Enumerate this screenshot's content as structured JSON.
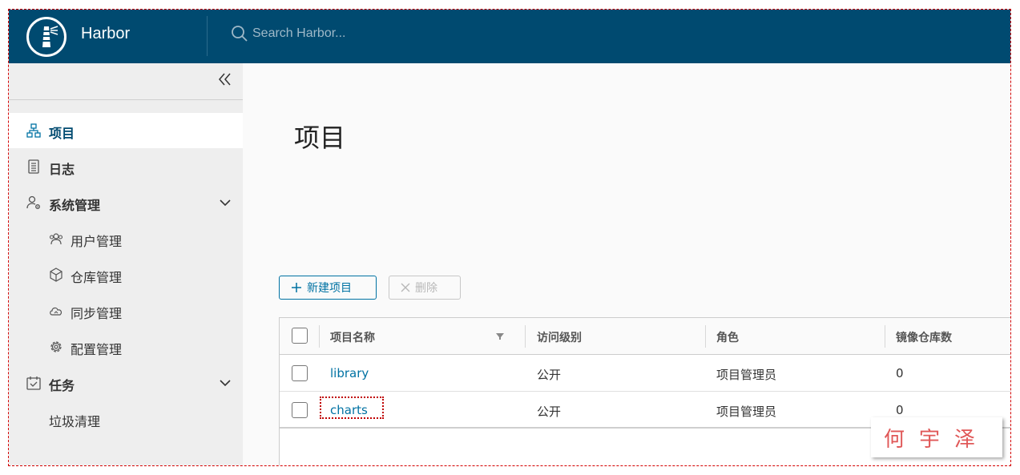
{
  "header": {
    "brand": "Harbor",
    "search_placeholder": "Search Harbor...",
    "color": "#004a70"
  },
  "sidebar": {
    "collapse_icon": "double-chevron-left-icon",
    "items": [
      {
        "label": "项目",
        "icon": "projects-icon",
        "active": true
      },
      {
        "label": "日志",
        "icon": "logs-icon"
      },
      {
        "label": "系统管理",
        "icon": "admin-icon",
        "expanded": true,
        "children": [
          {
            "label": "用户管理",
            "icon": "users-icon"
          },
          {
            "label": "仓库管理",
            "icon": "registry-icon"
          },
          {
            "label": "同步管理",
            "icon": "replication-icon"
          },
          {
            "label": "配置管理",
            "icon": "gear-icon"
          }
        ]
      },
      {
        "label": "任务",
        "icon": "tasks-icon",
        "expanded": true,
        "children": [
          {
            "label": "垃圾清理"
          }
        ]
      }
    ]
  },
  "main": {
    "title": "项目",
    "new_button": "新建项目",
    "delete_button": "删除",
    "table": {
      "columns": [
        "项目名称",
        "访问级别",
        "角色",
        "镜像仓库数"
      ],
      "rows": [
        {
          "name": "library",
          "access": "公开",
          "role": "项目管理员",
          "repo_count": "0"
        },
        {
          "name": "charts",
          "access": "公开",
          "role": "项目管理员",
          "repo_count": "0"
        }
      ]
    }
  },
  "watermark": "何宇泽"
}
